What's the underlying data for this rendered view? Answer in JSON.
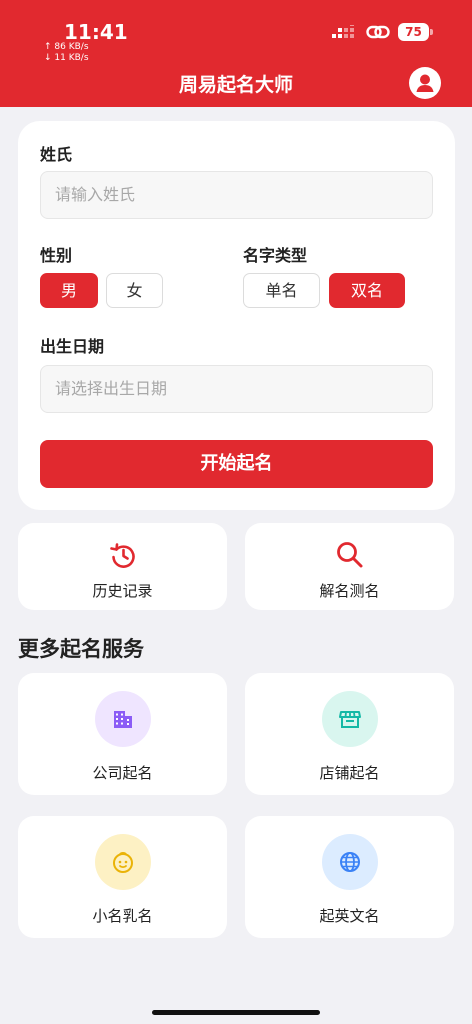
{
  "status_bar": {
    "time": "11:41",
    "upload_speed": "↑ 86 KB/s",
    "download_speed": "↓ 11 KB/s",
    "battery": "75"
  },
  "header": {
    "title": "周易起名大师"
  },
  "form": {
    "surname_label": "姓氏",
    "surname_placeholder": "请输入姓氏",
    "gender_label": "性别",
    "gender_male": "男",
    "gender_female": "女",
    "gender_selected": "男",
    "name_type_label": "名字类型",
    "name_single": "单名",
    "name_double": "双名",
    "name_type_selected": "双名",
    "birth_label": "出生日期",
    "birth_placeholder": "请选择出生日期",
    "submit": "开始起名"
  },
  "tools": [
    {
      "label": "历史记录",
      "icon": "history-icon"
    },
    {
      "label": "解名测名",
      "icon": "search-icon"
    }
  ],
  "more_services": {
    "title": "更多起名服务",
    "items": [
      {
        "label": "公司起名",
        "icon": "building-icon"
      },
      {
        "label": "店铺起名",
        "icon": "store-icon"
      },
      {
        "label": "小名乳名",
        "icon": "baby-face-icon"
      },
      {
        "label": "起英文名",
        "icon": "globe-icon"
      }
    ]
  },
  "colors": {
    "accent": "#e1292f",
    "building": "#8b5cf6",
    "store": "#14b8a6",
    "baby": "#eab308",
    "globe": "#3b82f6"
  }
}
